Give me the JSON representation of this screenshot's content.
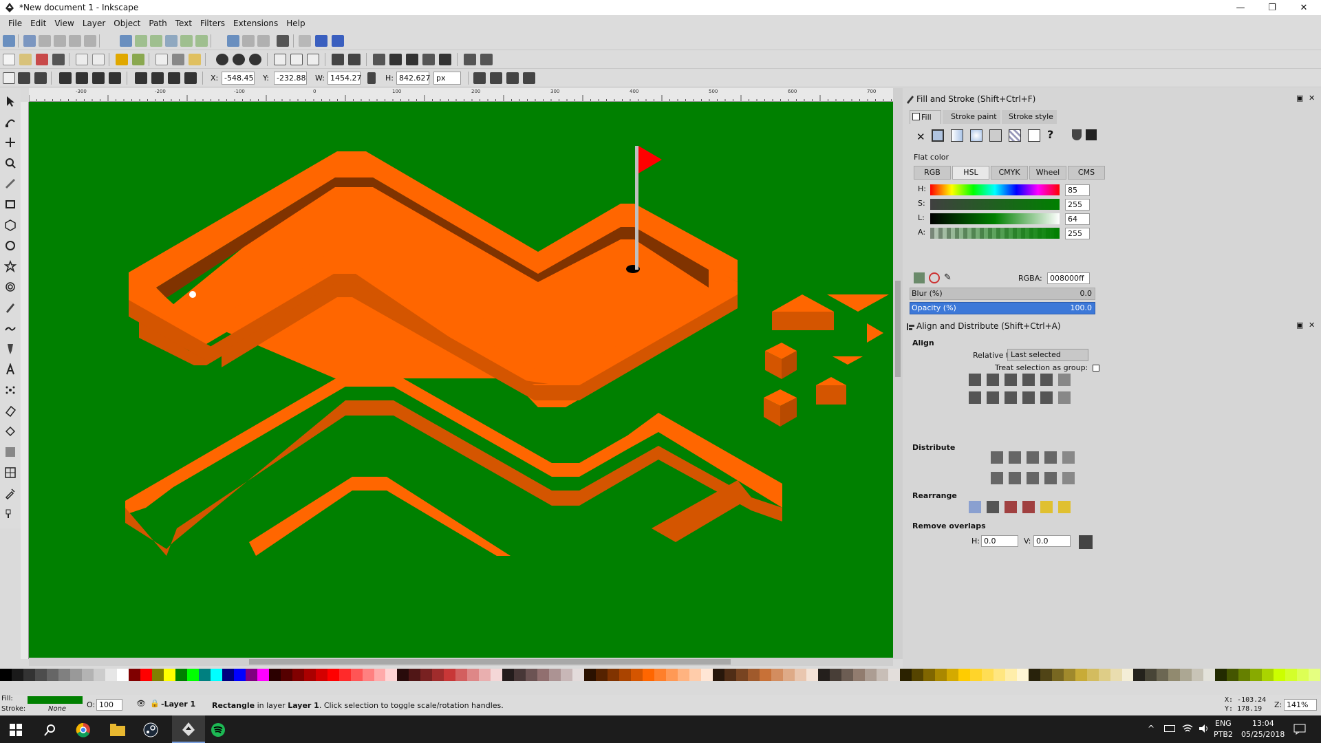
{
  "window": {
    "title": "*New document 1 - Inkscape",
    "min": "—",
    "max": "❐",
    "close": "✕"
  },
  "menu": [
    "File",
    "Edit",
    "View",
    "Layer",
    "Object",
    "Path",
    "Text",
    "Filters",
    "Extensions",
    "Help"
  ],
  "toolcontrols": {
    "x_label": "X:",
    "x_value": "-548.45",
    "y_label": "Y:",
    "y_value": "-232.88",
    "w_label": "W:",
    "w_value": "1454.27",
    "h_label": "H:",
    "h_value": "842.627",
    "unit": "px"
  },
  "fill_stroke": {
    "title": "Fill and Stroke (Shift+Ctrl+F)",
    "tabs": [
      "Fill",
      "Stroke paint",
      "Stroke style"
    ],
    "flat_color": "Flat color",
    "modes": [
      "RGB",
      "HSL",
      "CMYK",
      "Wheel",
      "CMS"
    ],
    "channels": [
      {
        "label": "H:",
        "value": "85"
      },
      {
        "label": "S:",
        "value": "255"
      },
      {
        "label": "L:",
        "value": "64"
      },
      {
        "label": "A:",
        "value": "255"
      }
    ],
    "rgba_label": "RGBA:",
    "rgba_value": "008000ff",
    "blur_label": "Blur (%)",
    "blur_value": "0.0",
    "opacity_label": "Opacity (%)",
    "opacity_value": "100.0"
  },
  "align": {
    "title": "Align and Distribute (Shift+Ctrl+A)",
    "align_heading": "Align",
    "relative_label": "Relative to:",
    "relative_value": "Last selected",
    "treat_group": "Treat selection as group:",
    "distribute": "Distribute",
    "rearrange": "Rearrange",
    "remove_overlaps": "Remove overlaps",
    "h_label": "H:",
    "h_value": "0.0",
    "v_label": "V:",
    "v_value": "0.0"
  },
  "status": {
    "fill_label": "Fill:",
    "stroke_label": "Stroke:",
    "stroke_value": "None",
    "opacity_label": "O:",
    "opacity_value": "100",
    "layer": "-Layer 1",
    "message_bold": "Rectangle",
    "message_mid": " in layer ",
    "message_layer": "Layer 1",
    "message_rest": ". Click selection to toggle scale/rotation handles.",
    "cursor_x": "X: -103.24",
    "cursor_y": "Y: 178.19",
    "zoom_label": "Z:",
    "zoom_value": "141%"
  },
  "taskbar": {
    "lang": "ENG",
    "lang2": "PTB2",
    "time": "13:04",
    "date": "05/25/2018"
  },
  "ruler_ticks": [
    "-300",
    "-200",
    "-100",
    "0",
    "100",
    "200",
    "300",
    "400",
    "500",
    "600",
    "700"
  ],
  "colors": {
    "canvas": "#008000",
    "wall_top": "#ff6600",
    "wall_side": "#d45500",
    "wall_inner": "#803300",
    "flag": "#ff0000",
    "fill_swatch": "#008000"
  }
}
